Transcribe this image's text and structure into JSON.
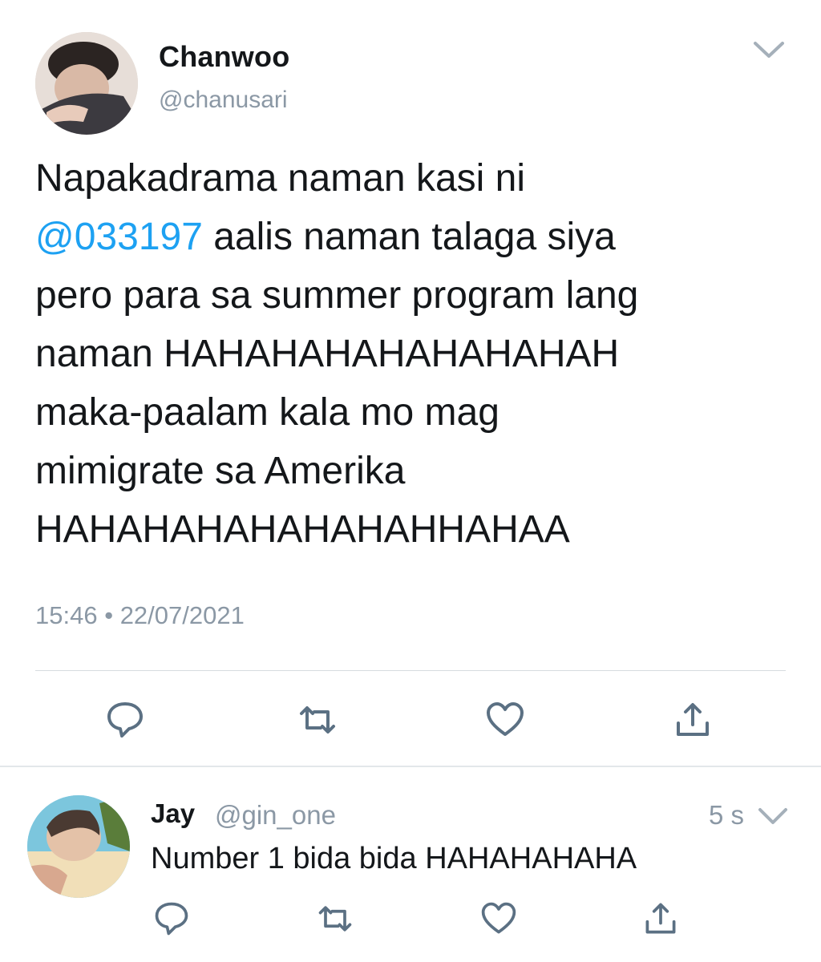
{
  "tweet": {
    "author_name": "Chanwoo",
    "author_handle": "@chanusari",
    "text_before_mention": "Napakadrama naman kasi ni\n",
    "mention": "@033197",
    "text_after_mention": " aalis naman talaga siya\npero para sa summer program lang\nnaman HAHAHAHAHAHAHAHAH\nmaka-paalam kala mo mag\nmimigrate sa Amerika\nHAHAHAHAHAHAHAHHAHAA",
    "time": "15:46",
    "separator": "•",
    "date": "22/07/2021"
  },
  "reply": {
    "author_name": "Jay",
    "author_handle": "@gin_one",
    "time_ago": "5 s",
    "text": "Number 1 bida bida HAHAHAHAHA"
  },
  "icons": {
    "reply": "speech-bubble-icon",
    "retweet": "retweet-arrows-icon",
    "like": "heart-outline-icon",
    "share": "share-upload-icon",
    "menu": "chevron-down-icon"
  },
  "colors": {
    "text": "#14171a",
    "secondary": "#8b98a5",
    "link": "#1da1f2",
    "icon": "#5b7083"
  }
}
